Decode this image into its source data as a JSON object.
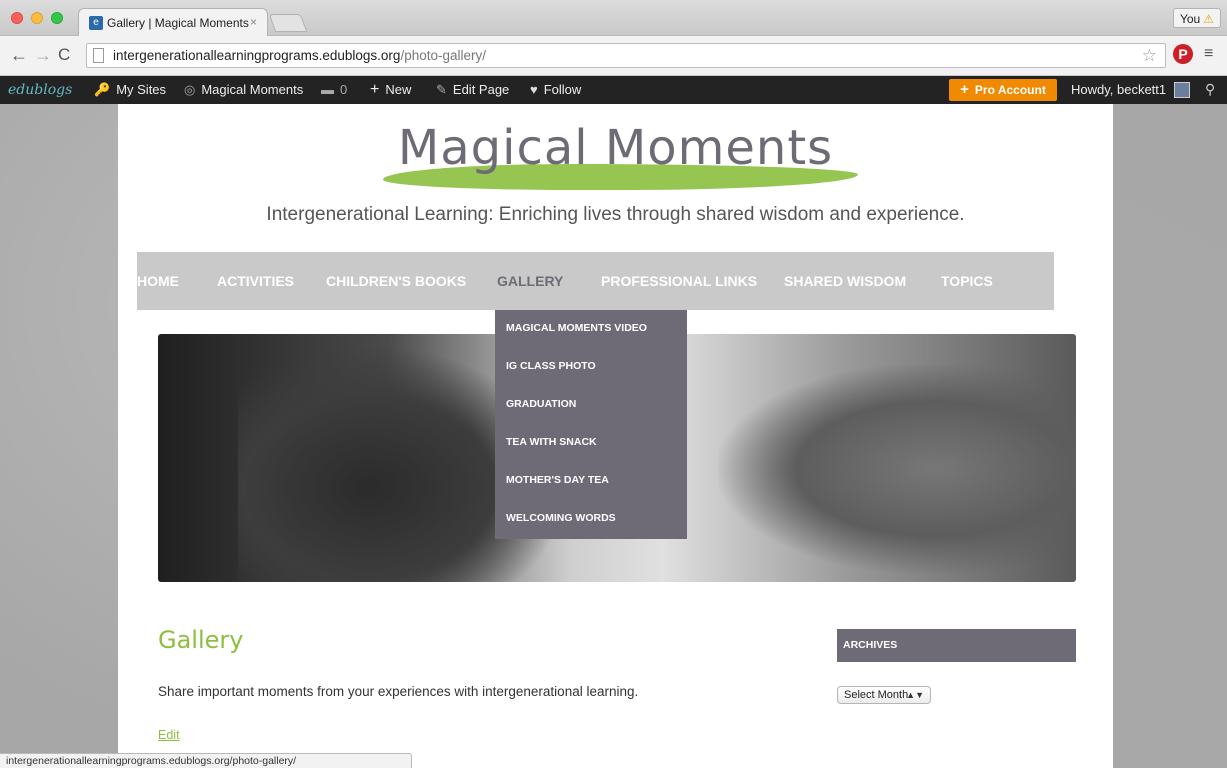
{
  "browser": {
    "tab_title": "Gallery | Magical Moments",
    "tab_close": "×",
    "profile_label": "You",
    "profile_warning": "⚠",
    "url_domain": "intergenerationallearningprograms.edublogs.org",
    "url_path": "/photo-gallery/",
    "status_url": "intergenerationallearningprograms.edublogs.org/photo-gallery/"
  },
  "adminbar": {
    "logo": "edublogs",
    "my_sites": "My Sites",
    "site_name": "Magical Moments",
    "comments_count": "0",
    "new_label": "New",
    "edit_page": "Edit Page",
    "follow": "Follow",
    "pro_account": "Pro Account",
    "howdy": "Howdy, beckett1"
  },
  "site": {
    "title": "Magical Moments",
    "tagline": "Intergenerational Learning: Enriching lives through shared wisdom and experience.",
    "accent_color": "#8cbf3f",
    "nav_color": "#6f6b76"
  },
  "nav": {
    "items": [
      "HOME",
      "ACTIVITIES",
      "CHILDREN'S BOOKS",
      "GALLERY",
      "PROFESSIONAL LINKS",
      "SHARED WISDOM",
      "TOPICS"
    ],
    "active": "GALLERY"
  },
  "dropdown": {
    "items": [
      "MAGICAL MOMENTS VIDEO",
      "IG CLASS PHOTO",
      "GRADUATION",
      "TEA WITH SNACK",
      "MOTHER'S DAY TEA",
      "WELCOMING WORDS"
    ]
  },
  "main": {
    "page_title": "Gallery",
    "intro": "Share important moments from your experiences with intergenerational learning.",
    "edit_link": "Edit"
  },
  "sidebar": {
    "archives_title": "ARCHIVES",
    "select_value": "Select Month"
  }
}
